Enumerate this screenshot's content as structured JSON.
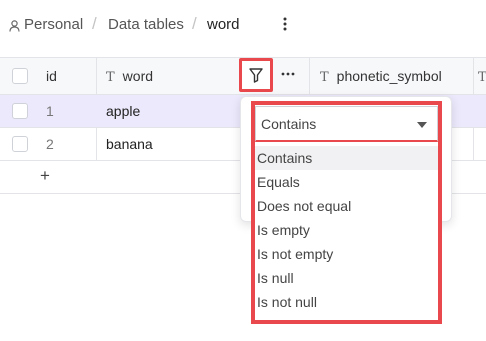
{
  "breadcrumb": {
    "items": [
      "Personal",
      "Data tables",
      "word"
    ]
  },
  "table": {
    "columns": [
      {
        "label": "id"
      },
      {
        "label": "word",
        "type_icon": "T"
      },
      {
        "label": "phonetic_symbol",
        "type_icon": "T"
      }
    ],
    "rows": [
      {
        "id": "1",
        "word": "apple",
        "selected": true
      },
      {
        "id": "2",
        "word": "banana",
        "selected": false
      }
    ],
    "add_row_label": "+"
  },
  "filter": {
    "selected_operator": "Contains",
    "operators": [
      "Contains",
      "Equals",
      "Does not equal",
      "Is empty",
      "Is not empty",
      "Is null",
      "Is not null"
    ]
  },
  "colors": {
    "highlight": "#e9484d",
    "selected_row": "#ebe9fb",
    "header_bg": "#f7f8fa"
  },
  "icons": {
    "person": "person-icon",
    "more": "more-vertical-icon",
    "filter": "filter-icon",
    "column_more": "more-horizontal-icon"
  }
}
